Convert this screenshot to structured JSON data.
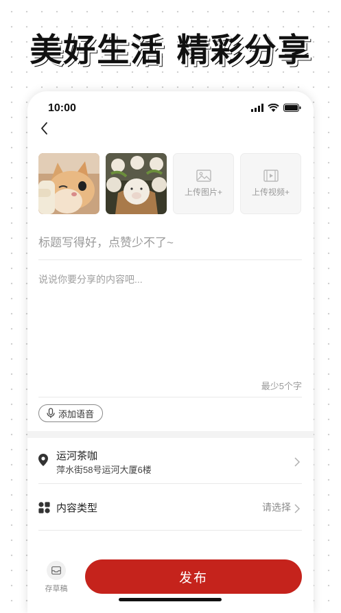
{
  "banner": {
    "text": "美好生活  精彩分享"
  },
  "status_bar": {
    "time": "10:00"
  },
  "media": {
    "images": [
      {
        "alt": "cat photo"
      },
      {
        "alt": "piglet figurines photo"
      }
    ],
    "upload_image_label": "上传图片+",
    "upload_video_label": "上传视频+"
  },
  "post": {
    "title_placeholder": "标题写得好，点赞少不了~",
    "body_placeholder": "说说你要分享的内容吧...",
    "min_chars_hint": "最少5个字",
    "add_voice_label": "添加语音"
  },
  "location": {
    "name": "运河茶咖",
    "address": "萍水街58号运河大厦6楼"
  },
  "content_type": {
    "label": "内容类型",
    "value": "请选择"
  },
  "footer": {
    "draft_label": "存草稿",
    "publish_label": "发布"
  },
  "colors": {
    "accent": "#c5231c",
    "placeholder": "#9a9a9a"
  }
}
